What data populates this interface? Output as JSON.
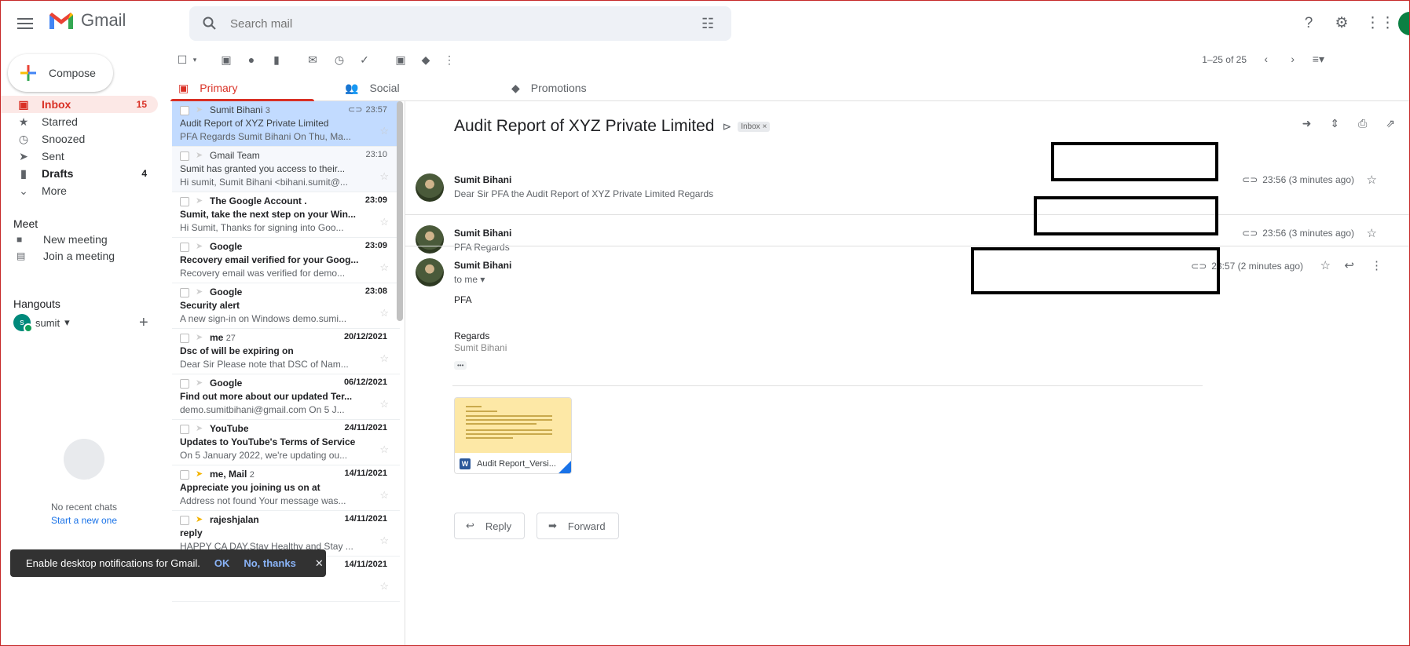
{
  "app": {
    "name": "Gmail"
  },
  "search": {
    "placeholder": "Search mail"
  },
  "compose": {
    "label": "Compose"
  },
  "nav": [
    {
      "label": "Inbox",
      "count": "15",
      "icon": "inbox-icon"
    },
    {
      "label": "Starred",
      "count": "",
      "icon": "star-icon"
    },
    {
      "label": "Snoozed",
      "count": "",
      "icon": "clock-icon"
    },
    {
      "label": "Sent",
      "count": "",
      "icon": "send-icon"
    },
    {
      "label": "Drafts",
      "count": "4",
      "icon": "draft-icon"
    },
    {
      "label": "More",
      "count": "",
      "icon": "chevron-down-icon"
    }
  ],
  "meet": {
    "title": "Meet",
    "new_meeting": "New meeting",
    "join": "Join a meeting"
  },
  "hangouts": {
    "title": "Hangouts",
    "user_initial": "s",
    "user": "sumit",
    "no_chats": "No recent chats",
    "start_new": "Start a new one"
  },
  "pager": {
    "text": "1–25 of 25"
  },
  "tabs": [
    {
      "label": "Primary"
    },
    {
      "label": "Social"
    },
    {
      "label": "Promotions"
    }
  ],
  "mails": [
    {
      "sender": "Sumit Bihani",
      "count": "3",
      "date": "23:57",
      "subject": "Audit Report of XYZ Private Limited",
      "snippet": "PFA Regards Sumit Bihani On Thu, Ma...",
      "unread": false,
      "selected": true,
      "important": false,
      "attach": true
    },
    {
      "sender": "Gmail Team",
      "count": "",
      "date": "23:10",
      "subject": "Sumit has granted you access to their...",
      "snippet": "Hi sumit, Sumit Bihani <bihani.sumit@...",
      "unread": false,
      "selected": false,
      "important": false,
      "attach": false
    },
    {
      "sender": "The Google Account .",
      "count": "",
      "date": "23:09",
      "subject": "Sumit, take the next step on your Win...",
      "snippet": "Hi Sumit, Thanks for signing into Goo...",
      "unread": true,
      "selected": false,
      "important": false,
      "attach": false
    },
    {
      "sender": "Google",
      "count": "",
      "date": "23:09",
      "subject": "Recovery email verified for your Goog...",
      "snippet": "Recovery email was verified for demo...",
      "unread": true,
      "selected": false,
      "important": false,
      "attach": false
    },
    {
      "sender": "Google",
      "count": "",
      "date": "23:08",
      "subject": "Security alert",
      "snippet": "A new sign-in on Windows demo.sumi...",
      "unread": true,
      "selected": false,
      "important": false,
      "attach": false
    },
    {
      "sender": "me",
      "count": "27",
      "date": "20/12/2021",
      "subject": "Dsc of will be expiring on",
      "snippet": "Dear Sir Please note that DSC of Nam...",
      "unread": true,
      "selected": false,
      "important": false,
      "attach": false
    },
    {
      "sender": "Google",
      "count": "",
      "date": "06/12/2021",
      "subject": "Find out more about our updated Ter...",
      "snippet": "demo.sumitbihani@gmail.com On 5 J...",
      "unread": true,
      "selected": false,
      "important": false,
      "attach": false
    },
    {
      "sender": "YouTube",
      "count": "",
      "date": "24/11/2021",
      "subject": "Updates to YouTube's Terms of Service",
      "snippet": "On 5 January 2022, we're updating ou...",
      "unread": true,
      "selected": false,
      "important": false,
      "attach": false
    },
    {
      "sender": "me, Mail",
      "count": "2",
      "date": "14/11/2021",
      "subject": "Appreciate you joining us on at",
      "snippet": "Address not found Your message was...",
      "unread": true,
      "selected": false,
      "important": true,
      "attach": false
    },
    {
      "sender": "rajeshjalan",
      "count": "",
      "date": "14/11/2021",
      "subject": "reply",
      "snippet": "HAPPY CA DAY,Stay Healthy and Stay ...",
      "unread": true,
      "selected": false,
      "important": true,
      "attach": false
    },
    {
      "sender": "",
      "count": "",
      "date": "14/11/2021",
      "subject": "",
      "snippet": "",
      "unread": true,
      "selected": false,
      "important": false,
      "attach": false
    }
  ],
  "thread": {
    "subject": "Audit Report of XYZ Private Limited",
    "label": "Inbox ×",
    "messages": [
      {
        "from": "Sumit Bihani",
        "snippet": "Dear Sir PFA the Audit Report of XYZ Private Limited Regards",
        "time": "23:56 (3 minutes ago)"
      },
      {
        "from": "Sumit Bihani",
        "snippet": "PFA Regards",
        "time": "23:56 (3 minutes ago)"
      },
      {
        "from": "Sumit Bihani",
        "to": "to me",
        "time": "23:57 (2 minutes ago)",
        "body": "PFA",
        "regards": "Regards",
        "signature": "Sumit Bihani",
        "more": "•••"
      }
    ],
    "attachment": {
      "name": "Audit Report_Versi..."
    },
    "reply": "Reply",
    "forward": "Forward"
  },
  "snackbar": {
    "text": "Enable desktop notifications for Gmail.",
    "ok": "OK",
    "no": "No, thanks",
    "close": "✕"
  },
  "colors": {
    "accent": "#d93025",
    "selected_row": "#c2dbff",
    "link": "#1a73e8"
  }
}
